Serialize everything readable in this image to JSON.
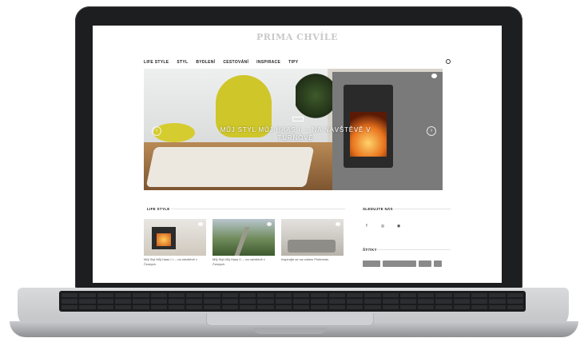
{
  "site": {
    "logo": "PRIMA CHVÍLE"
  },
  "nav": {
    "items": [
      "LIFE STYLE",
      "STYL",
      "BYDLENÍ",
      "CESTOVÁNÍ",
      "INSPIRACE",
      "TIPY"
    ]
  },
  "hero": {
    "title": "MŮJ STYL MŮJ HAAS I. – NA NÁVŠTĚVĚ V TURNOVĚ"
  },
  "life_style": {
    "heading": "LIFE STYLE",
    "cards": [
      {
        "caption": "Můj Styl Můj Haas I.I. – na návštěvě v Českých"
      },
      {
        "caption": "Můj Styl Můj Haas II. – na návštěvě v Českých"
      },
      {
        "caption": "Inspirujte se na našem Pinterestu"
      }
    ]
  },
  "sidebar": {
    "follow_heading": "SLEDUJTE NÁS",
    "tags_heading": "ŠTÍTKY",
    "social": [
      "f",
      "◎",
      "◉"
    ]
  },
  "colors": {
    "accent_yellow": "#cfc62a",
    "nav_text": "#222222"
  }
}
